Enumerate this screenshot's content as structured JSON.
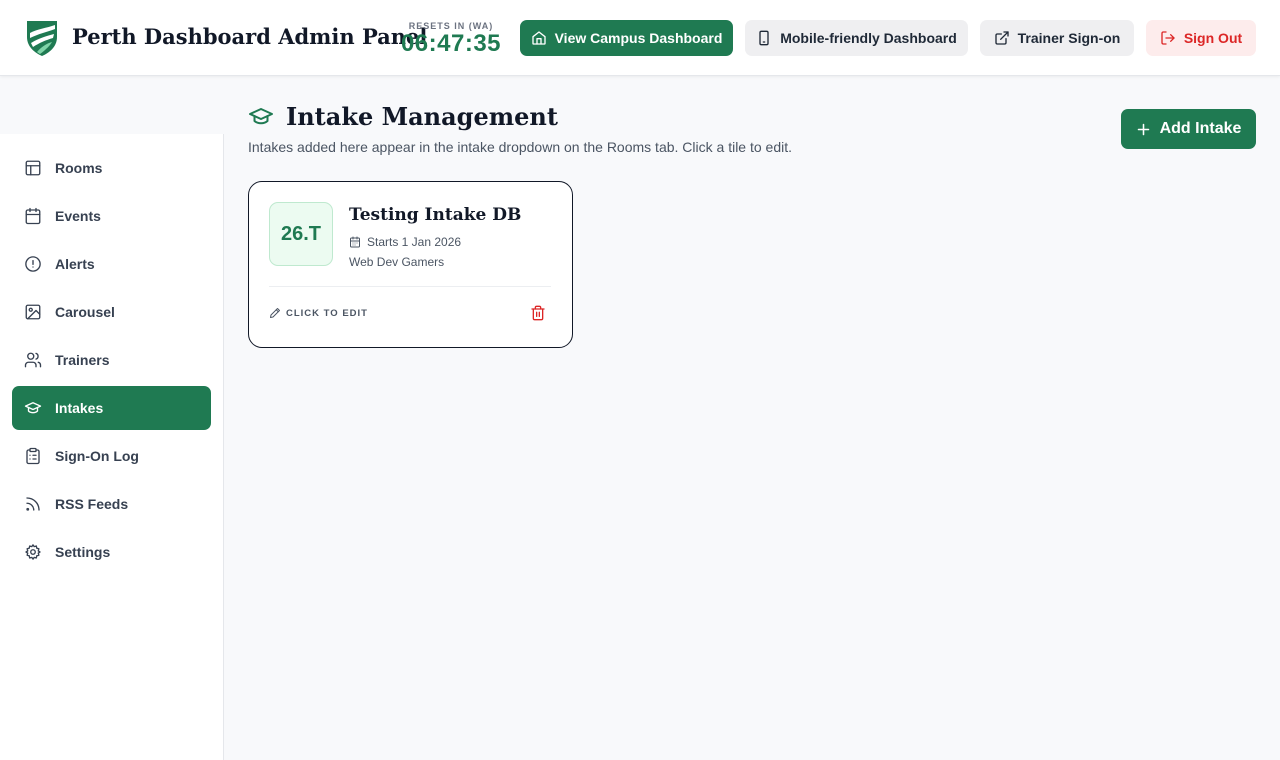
{
  "header": {
    "app_title": "Perth Dashboard Admin Panel",
    "timer_label": "RESETS IN (WA)",
    "timer_value": "06:47:35",
    "buttons": {
      "campus": "View Campus Dashboard",
      "mobile": "Mobile-friendly Dashboard",
      "trainer": "Trainer Sign-on",
      "signout": "Sign Out"
    }
  },
  "sidebar": {
    "items": [
      {
        "label": "Rooms",
        "icon": "layout-icon"
      },
      {
        "label": "Events",
        "icon": "calendar-icon"
      },
      {
        "label": "Alerts",
        "icon": "alert-circle-icon"
      },
      {
        "label": "Carousel",
        "icon": "image-icon"
      },
      {
        "label": "Trainers",
        "icon": "users-icon"
      },
      {
        "label": "Intakes",
        "icon": "graduation-cap-icon",
        "active": true
      },
      {
        "label": "Sign-On Log",
        "icon": "clipboard-icon"
      },
      {
        "label": "RSS Feeds",
        "icon": "rss-icon"
      },
      {
        "label": "Settings",
        "icon": "gear-icon"
      }
    ]
  },
  "main": {
    "title": "Intake Management",
    "subtitle": "Intakes added here appear in the intake dropdown on the Rooms tab. Click a tile to edit.",
    "add_button": "Add Intake",
    "intakes": [
      {
        "code": "26.T",
        "name": "Testing Intake DB",
        "start": "Starts 1 Jan 2026",
        "group": "Web Dev Gamers",
        "edit_label": "CLICK TO EDIT"
      }
    ]
  },
  "colors": {
    "brand": "#1f7a52",
    "danger": "#dc2626",
    "danger_bg": "#fdecec",
    "badge_bg": "#ecfbf1"
  }
}
